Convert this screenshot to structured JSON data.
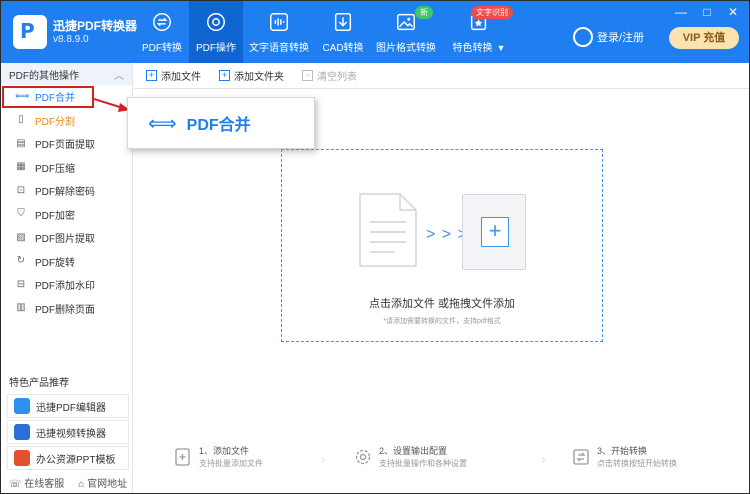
{
  "app": {
    "name": "迅捷PDF转换器",
    "version": "v8.8.9.0"
  },
  "nav": [
    {
      "label": "PDF转换",
      "icon": "pdf-convert-icon"
    },
    {
      "label": "PDF操作",
      "icon": "pdf-operate-icon"
    },
    {
      "label": "文字语音转换",
      "icon": "voice-wave-icon"
    },
    {
      "label": "CAD转换",
      "icon": "cad-icon"
    },
    {
      "label": "图片格式转换",
      "icon": "image-icon",
      "badge": "新"
    },
    {
      "label": "特色转换",
      "icon": "star-convert-icon",
      "badge": "文字识别"
    }
  ],
  "login": {
    "label": "登录/注册"
  },
  "vip": {
    "label": "VIP 充值"
  },
  "window": {
    "minimize": "—",
    "restore": "□",
    "close": "✕"
  },
  "sidebar": {
    "section_title": "PDF的其他操作",
    "collapse_glyph": "︿",
    "items": [
      {
        "label": "PDF合并",
        "icon": "merge-icon"
      },
      {
        "label": "PDF分割",
        "icon": "split-icon"
      },
      {
        "label": "PDF页面提取",
        "icon": "page-extract-icon"
      },
      {
        "label": "PDF压缩",
        "icon": "compress-icon"
      },
      {
        "label": "PDF解除密码",
        "icon": "unlock-icon"
      },
      {
        "label": "PDF加密",
        "icon": "shield-icon"
      },
      {
        "label": "PDF图片提取",
        "icon": "image-extract-icon"
      },
      {
        "label": "PDF旋转",
        "icon": "rotate-icon"
      },
      {
        "label": "PDF添加水印",
        "icon": "watermark-icon"
      },
      {
        "label": "PDF删除页面",
        "icon": "delete-page-icon"
      }
    ],
    "products_title": "特色产品推荐",
    "products": [
      {
        "label": "迅捷PDF编辑器",
        "color": "#2e8ff2"
      },
      {
        "label": "迅捷视频转换器",
        "color": "#2c6fd8"
      },
      {
        "label": "办公资源PPT模板",
        "color": "#e2502e"
      }
    ],
    "footer": {
      "service": "在线客服",
      "website": "官网地址"
    }
  },
  "toolbar": {
    "add_file": "添加文件",
    "add_folder": "添加文件夹",
    "clear_list": "清空列表"
  },
  "callout": {
    "label": "PDF合并"
  },
  "dropzone": {
    "title": "点击添加文件 或拖拽文件添加",
    "subtitle": "*请添加需要转换的文件，支持pdf格式",
    "arrows": "> > >",
    "plus": "+"
  },
  "steps": [
    {
      "title": "1、添加文件",
      "desc": "支持批量添加文件"
    },
    {
      "title": "2、设置输出配置",
      "desc": "支持批量操作和各种设置"
    },
    {
      "title": "3、开始转换",
      "desc": "点击转换按钮开始转换"
    }
  ],
  "colors": {
    "primary": "#1f7ff0",
    "active_nav": "#0f66d0",
    "accent_orange": "#e8891c",
    "highlight_red": "#d32222"
  }
}
